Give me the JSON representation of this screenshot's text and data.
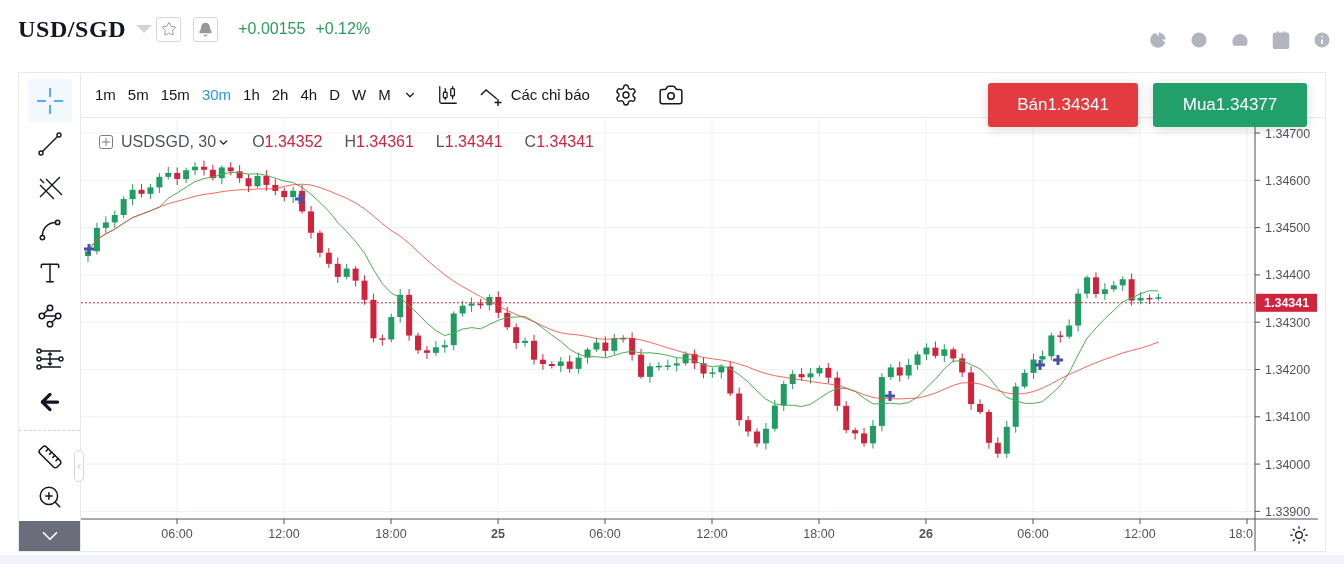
{
  "header": {
    "symbol": "USD/SGD",
    "change": "+0.00155",
    "change_percent": "+0.12%"
  },
  "tools": [
    {
      "kind": "crosshair",
      "selected": true
    },
    {
      "kind": "trend-line",
      "selected": false
    },
    {
      "kind": "pitchfork",
      "selected": false
    },
    {
      "kind": "brush",
      "selected": false
    },
    {
      "kind": "text",
      "selected": false
    },
    {
      "kind": "pattern",
      "selected": false
    },
    {
      "kind": "levels",
      "selected": false
    },
    {
      "kind": "back",
      "selected": false
    }
  ],
  "measure_tools": [
    {
      "kind": "ruler"
    },
    {
      "kind": "zoom"
    }
  ],
  "timeframes": [
    {
      "label": "1m",
      "selected": false
    },
    {
      "label": "5m",
      "selected": false
    },
    {
      "label": "15m",
      "selected": false
    },
    {
      "label": "30m",
      "selected": true
    },
    {
      "label": "1h",
      "selected": false
    },
    {
      "label": "2h",
      "selected": false
    },
    {
      "label": "4h",
      "selected": false
    },
    {
      "label": "D",
      "selected": false
    },
    {
      "label": "W",
      "selected": false
    },
    {
      "label": "M",
      "selected": false
    }
  ],
  "indicators_button": "Các chỉ báo",
  "legend": {
    "symbol": "USDSGD, 30",
    "values": [
      {
        "key": "O",
        "value": "1.34352"
      },
      {
        "key": "H",
        "value": "1.34361"
      },
      {
        "key": "L",
        "value": "1.34341"
      },
      {
        "key": "C",
        "value": "1.34341"
      }
    ]
  },
  "sell_button": {
    "label": "Bán",
    "price": "1.34341"
  },
  "buy_button": {
    "label": "Mua",
    "price": "1.34377"
  },
  "price_axis": {
    "ticks": [
      "1.34700",
      "1.34600",
      "1.34500",
      "1.34400",
      "1.34300",
      "1.34200",
      "1.34100",
      "1.34000",
      "1.33900"
    ],
    "current_price": "1.34341"
  },
  "time_axis": {
    "ticks": [
      {
        "label": "06:00",
        "bold": false
      },
      {
        "label": "12:00",
        "bold": false
      },
      {
        "label": "18:00",
        "bold": false
      },
      {
        "label": "25",
        "bold": true
      },
      {
        "label": "06:00",
        "bold": false
      },
      {
        "label": "12:00",
        "bold": false
      },
      {
        "label": "18:00",
        "bold": false
      },
      {
        "label": "26",
        "bold": true
      },
      {
        "label": "06:00",
        "bold": false
      },
      {
        "label": "12:00",
        "bold": false
      },
      {
        "label": "18:0",
        "bold": false
      }
    ]
  }
}
